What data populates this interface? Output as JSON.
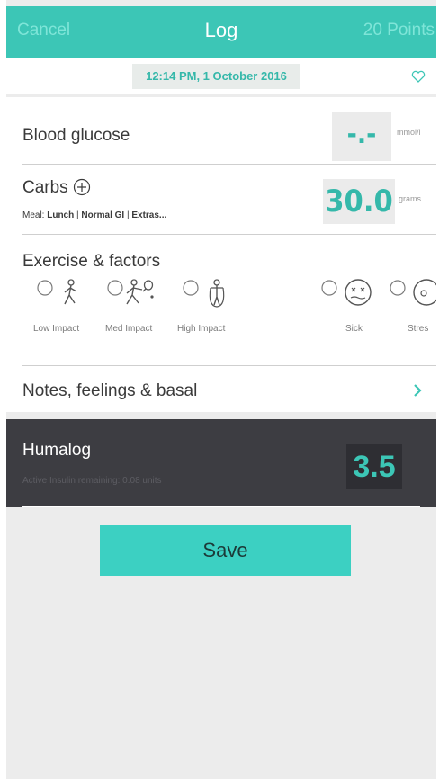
{
  "header": {
    "cancel": "Cancel",
    "title": "Log",
    "points": "20 Points"
  },
  "datetime": "12:14 PM, 1 October 2016",
  "blood_glucose": {
    "label": "Blood glucose",
    "value": "-.-",
    "unit": "mmol/l"
  },
  "carbs": {
    "label": "Carbs",
    "meal_prefix": "Meal:",
    "meal": "Lunch",
    "gi": "Normal GI",
    "extras": "Extras...",
    "value": "30.0",
    "unit": "grams"
  },
  "exercise": {
    "title": "Exercise & factors",
    "items": [
      "Low Impact",
      "Med Impact",
      "High Impact",
      "Sick",
      "Stres"
    ]
  },
  "notes": {
    "label": "Notes, feelings & basal"
  },
  "insulin": {
    "name": "Humalog",
    "active": "Active Insulin remaining: 0.08 units",
    "value": "3.5"
  },
  "save_label": "Save",
  "colors": {
    "teal": "#3cc6b6",
    "dark": "#3d3d42",
    "save": "#3cd0c2"
  },
  "icons": [
    "heart-icon",
    "plus-circle-icon",
    "walking-icon",
    "tennis-icon",
    "jump-rope-icon",
    "sick-face-icon",
    "stress-face-icon",
    "chevron-right-icon"
  ]
}
